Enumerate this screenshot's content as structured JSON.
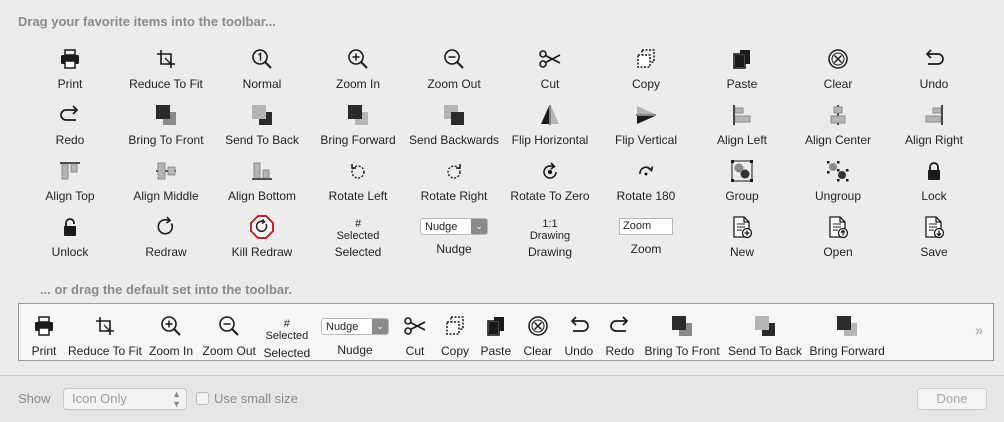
{
  "palette_heading": "Drag your favorite items into the toolbar...",
  "default_heading": "... or drag the default set into the toolbar.",
  "palette_items": [
    {
      "icon": "print-icon",
      "label": "Print"
    },
    {
      "icon": "reduce-to-fit-icon",
      "label": "Reduce To Fit"
    },
    {
      "icon": "zoom-normal-icon",
      "label": "Normal"
    },
    {
      "icon": "zoom-in-icon",
      "label": "Zoom In"
    },
    {
      "icon": "zoom-out-icon",
      "label": "Zoom Out"
    },
    {
      "icon": "scissors-icon",
      "label": "Cut"
    },
    {
      "icon": "copy-icon",
      "label": "Copy"
    },
    {
      "icon": "paste-icon",
      "label": "Paste"
    },
    {
      "icon": "clear-icon",
      "label": "Clear"
    },
    {
      "icon": "undo-icon",
      "label": "Undo"
    },
    {
      "icon": "redo-icon",
      "label": "Redo"
    },
    {
      "icon": "bring-to-front-icon",
      "label": "Bring To Front"
    },
    {
      "icon": "send-to-back-icon",
      "label": "Send To Back"
    },
    {
      "icon": "bring-forward-icon",
      "label": "Bring Forward"
    },
    {
      "icon": "send-backwards-icon",
      "label": "Send Backwards"
    },
    {
      "icon": "flip-horizontal-icon",
      "label": "Flip Horizontal"
    },
    {
      "icon": "flip-vertical-icon",
      "label": "Flip Vertical"
    },
    {
      "icon": "align-left-icon",
      "label": "Align Left"
    },
    {
      "icon": "align-center-icon",
      "label": "Align Center"
    },
    {
      "icon": "align-right-icon",
      "label": "Align Right"
    },
    {
      "icon": "align-top-icon",
      "label": "Align Top"
    },
    {
      "icon": "align-middle-icon",
      "label": "Align Middle"
    },
    {
      "icon": "align-bottom-icon",
      "label": "Align Bottom"
    },
    {
      "icon": "rotate-left-icon",
      "label": "Rotate Left"
    },
    {
      "icon": "rotate-right-icon",
      "label": "Rotate Right"
    },
    {
      "icon": "rotate-to-zero-icon",
      "label": "Rotate To Zero"
    },
    {
      "icon": "rotate-180-icon",
      "label": "Rotate 180"
    },
    {
      "icon": "group-icon",
      "label": "Group"
    },
    {
      "icon": "ungroup-icon",
      "label": "Ungroup"
    },
    {
      "icon": "lock-icon",
      "label": "Lock"
    },
    {
      "icon": "unlock-icon",
      "label": "Unlock"
    },
    {
      "icon": "redraw-icon",
      "label": "Redraw"
    },
    {
      "icon": "kill-redraw-icon",
      "label": "Kill Redraw"
    },
    {
      "kind": "text",
      "line1": "#",
      "line2": "Selected",
      "label": "Selected"
    },
    {
      "kind": "nudge",
      "value": "Nudge",
      "label": "Nudge"
    },
    {
      "kind": "text",
      "line1": "1:1",
      "line2": "Drawing",
      "label": "Drawing"
    },
    {
      "kind": "zoomfield",
      "value": "Zoom",
      "label": "Zoom"
    },
    {
      "icon": "new-document-icon",
      "label": "New"
    },
    {
      "icon": "open-document-icon",
      "label": "Open"
    },
    {
      "icon": "save-document-icon",
      "label": "Save"
    }
  ],
  "default_toolbar": [
    {
      "icon": "print-icon",
      "label": "Print"
    },
    {
      "icon": "reduce-to-fit-icon",
      "label": "Reduce To Fit"
    },
    {
      "icon": "zoom-in-icon",
      "label": "Zoom In"
    },
    {
      "icon": "zoom-out-icon",
      "label": "Zoom Out"
    },
    {
      "kind": "text",
      "line1": "#",
      "line2": "Selected",
      "label": "Selected"
    },
    {
      "kind": "nudge",
      "value": "Nudge",
      "label": "Nudge"
    },
    {
      "icon": "scissors-icon",
      "label": "Cut"
    },
    {
      "icon": "copy-icon",
      "label": "Copy"
    },
    {
      "icon": "paste-icon",
      "label": "Paste"
    },
    {
      "icon": "clear-icon",
      "label": "Clear"
    },
    {
      "icon": "undo-icon",
      "label": "Undo"
    },
    {
      "icon": "redo-icon",
      "label": "Redo"
    },
    {
      "icon": "bring-to-front-icon",
      "label": "Bring To Front"
    },
    {
      "icon": "send-to-back-icon",
      "label": "Send To Back"
    },
    {
      "icon": "bring-forward-icon",
      "label": "Bring Forward"
    }
  ],
  "overflow_glyph": "»",
  "footer": {
    "show_label": "Show",
    "show_value": "Icon Only",
    "small_size_label": "Use small size",
    "small_size_checked": false,
    "done_label": "Done"
  },
  "colors": {
    "kill_redraw": "#c0262c",
    "icon": "#1a1a1a"
  }
}
